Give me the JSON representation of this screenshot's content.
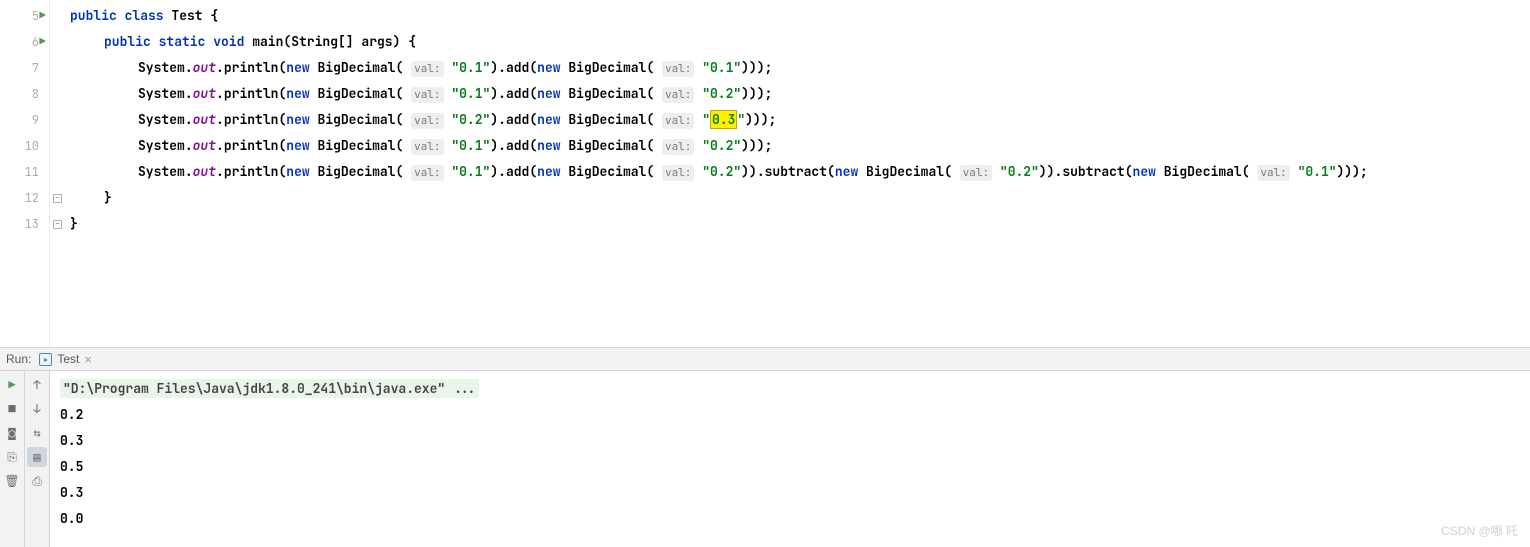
{
  "gutter": {
    "lines": [
      {
        "num": "5",
        "run": true,
        "fold": false
      },
      {
        "num": "6",
        "run": true,
        "fold": false
      },
      {
        "num": "7",
        "run": false,
        "fold": false
      },
      {
        "num": "8",
        "run": false,
        "fold": false
      },
      {
        "num": "9",
        "run": false,
        "fold": false
      },
      {
        "num": "10",
        "run": false,
        "fold": false
      },
      {
        "num": "11",
        "run": false,
        "fold": false
      },
      {
        "num": "12",
        "run": false,
        "fold": true
      },
      {
        "num": "13",
        "run": false,
        "fold": true
      }
    ]
  },
  "code": {
    "classDecl": {
      "t1": "public class ",
      "t2": "Test {"
    },
    "mainDecl": {
      "t1": "public static void ",
      "t2": "main(String[] args) {"
    },
    "hint": "val:",
    "sys": "System",
    "out": "out",
    "println": "println",
    "newKw": "new ",
    "bigDec": "BigDecimal",
    "add": "add",
    "sub": "subtract",
    "line7": {
      "s1": "\"0.1\"",
      "s2": "\"0.1\""
    },
    "line8": {
      "s1": "\"0.1\"",
      "s2": "\"0.2\""
    },
    "line9": {
      "s1": "\"0.2\"",
      "s2q": "\"",
      "s2hl": "0.3",
      "s2end": "\""
    },
    "line10": {
      "s1": "\"0.1\"",
      "s2": "\"0.2\""
    },
    "line11": {
      "s1": "\"0.1\"",
      "s2": "\"0.2\"",
      "s3": "\"0.2\"",
      "s4": "\"0.1\""
    },
    "closeBrace": "}"
  },
  "run": {
    "label": "Run:",
    "tabName": "Test",
    "closeGlyph": "×"
  },
  "console": {
    "exec": "\"D:\\Program Files\\Java\\jdk1.8.0_241\\bin\\java.exe\" ...",
    "out1": "0.2",
    "out2": "0.3",
    "out3": "0.5",
    "out4": "0.3",
    "out5": "0.0"
  },
  "watermark": "CSDN @哪 吒",
  "icons": {
    "play": "▶",
    "up": "↑",
    "down": "↓",
    "stop": "■",
    "camera": "◙",
    "wrap": "⇆",
    "print": "⎙",
    "exit": "⎘",
    "layout": "▤",
    "trash": "🗑"
  }
}
